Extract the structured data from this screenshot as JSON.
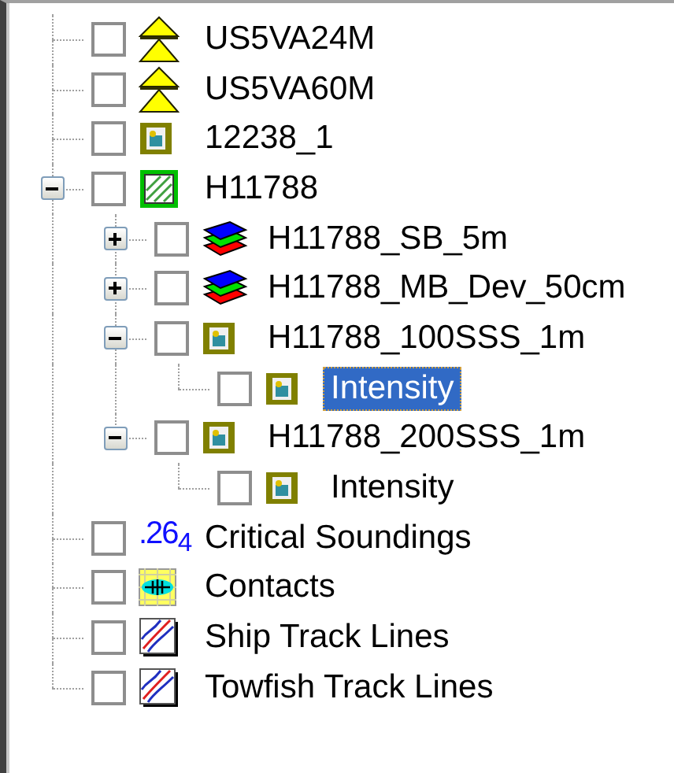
{
  "tree": {
    "items": [
      {
        "label": "US5VA24M",
        "kind": "chart",
        "checked": false,
        "selected": false
      },
      {
        "label": "US5VA60M",
        "kind": "chart",
        "checked": false,
        "selected": false
      },
      {
        "label": "12238_1",
        "kind": "raster",
        "checked": false,
        "selected": false
      },
      {
        "label": "H11788",
        "kind": "survey",
        "checked": false,
        "selected": false,
        "expanded": true,
        "children": [
          {
            "label": "H11788_SB_5m",
            "kind": "surface",
            "checked": false,
            "selected": false,
            "expanded": false
          },
          {
            "label": "H11788_MB_Dev_50cm",
            "kind": "surface",
            "checked": false,
            "selected": false,
            "expanded": false
          },
          {
            "label": "H11788_100SSS_1m",
            "kind": "raster",
            "checked": false,
            "selected": false,
            "expanded": true,
            "children": [
              {
                "label": "Intensity",
                "kind": "raster",
                "checked": false,
                "selected": true
              }
            ]
          },
          {
            "label": "H11788_200SSS_1m",
            "kind": "raster",
            "checked": false,
            "selected": false,
            "expanded": true,
            "children": [
              {
                "label": "Intensity",
                "kind": "raster",
                "checked": false,
                "selected": false
              }
            ]
          }
        ]
      },
      {
        "label": "Critical Soundings",
        "kind": "soundings",
        "icon_text": ".26$_{4}$",
        "checked": false,
        "selected": false
      },
      {
        "label": "Contacts",
        "kind": "contacts",
        "checked": false,
        "selected": false
      },
      {
        "label": "Ship Track Lines",
        "kind": "tracks",
        "checked": false,
        "selected": false
      },
      {
        "label": "Towfish Track Lines",
        "kind": "tracks",
        "checked": false,
        "selected": false
      }
    ]
  }
}
